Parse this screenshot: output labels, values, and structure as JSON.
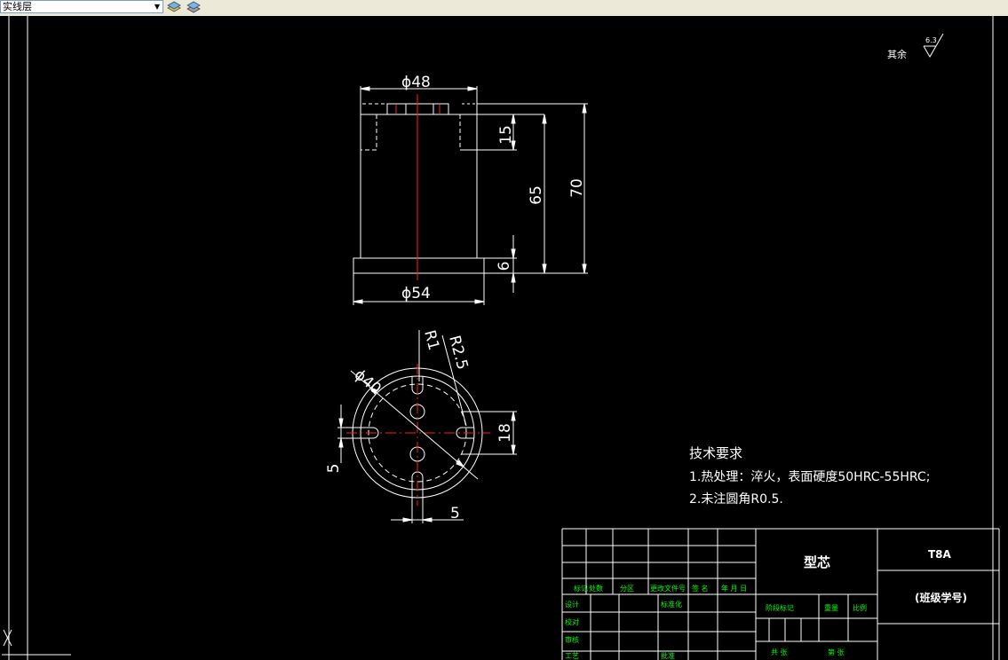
{
  "toolbar": {
    "layer_value": "实线层",
    "icons": [
      "layer-stack-icon",
      "layer-states-icon"
    ]
  },
  "drawing": {
    "surface_symbol": {
      "label": "其余",
      "value": "6.3"
    },
    "front_view": {
      "dim_top_dia": "ϕ48",
      "dim_bottom_dia": "ϕ54",
      "dim_slot_depth": "15",
      "dim_height_65": "65",
      "dim_height_70": "70",
      "dim_flange": "6"
    },
    "top_view": {
      "dim_dia40": "ϕ40",
      "dim_r1": "R1",
      "dim_r25": "R2.5",
      "dim_18": "18",
      "dim_5_left": "5",
      "dim_5_bottom": "5"
    },
    "tech_req": {
      "title": "技术要求",
      "line1": "1.热处理：淬火，表面硬度50HRC-55HRC;",
      "line2": "2.未注圆角R0.5."
    }
  },
  "title_block": {
    "part_name": "型芯",
    "material": "T8A",
    "class_id": "(班级学号)",
    "row_labels": [
      "标记",
      "处数",
      "分区",
      "更改文件号",
      "签 名",
      "年 月 日"
    ],
    "design": "设计",
    "standard": "标准化",
    "stage_mark": "阶段标记",
    "weight": "重量",
    "scale": "比例",
    "check": "校对",
    "review": "审核",
    "process": "工艺",
    "approve": "批准",
    "sheets": "共 张",
    "sheet_no": "第 张"
  },
  "colors": {
    "line": "#ffffff",
    "center": "#ff0000",
    "title_text": "#00ff00"
  }
}
